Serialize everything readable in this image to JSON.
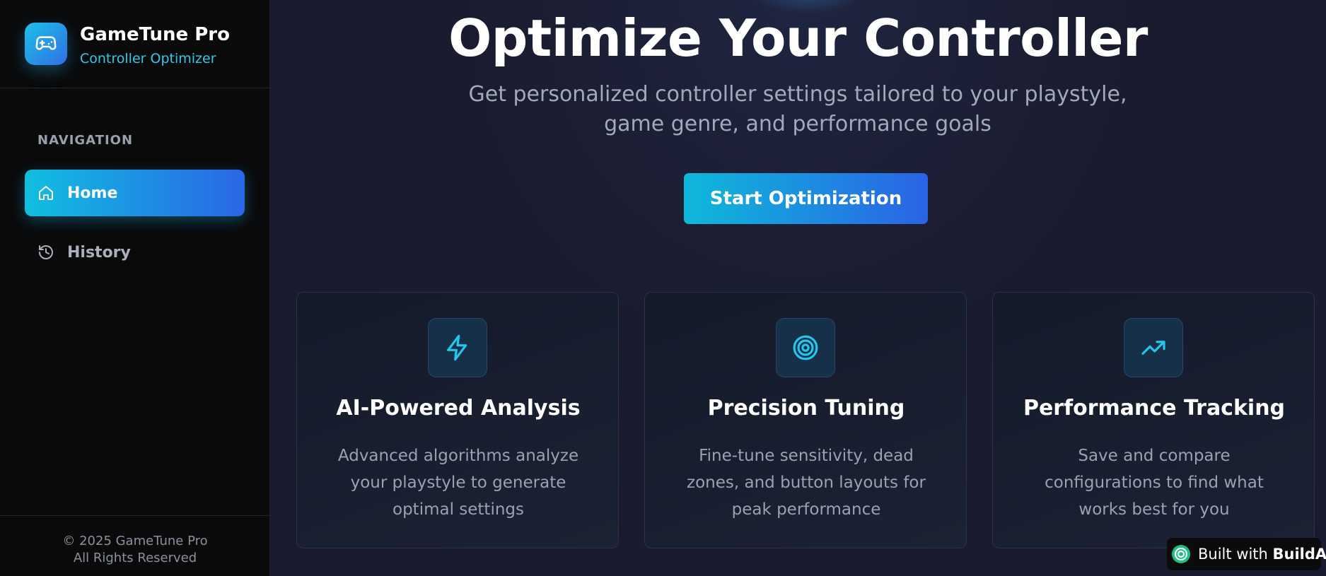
{
  "brand": {
    "title": "GameTune Pro",
    "subtitle": "Controller Optimizer",
    "logo_icon": "gamepad-icon"
  },
  "sidebar": {
    "heading": "NAVIGATION",
    "items": [
      {
        "label": "Home",
        "icon": "home-icon",
        "active": true
      },
      {
        "label": "History",
        "icon": "history-icon",
        "active": false
      }
    ],
    "footer": {
      "copyright": "© 2025 GameTune Pro",
      "rights": "All Rights Reserved"
    }
  },
  "hero": {
    "title": "Optimize Your Controller",
    "subtitle": "Get personalized controller settings tailored to your playstyle, game genre, and performance goals",
    "cta_label": "Start Optimization"
  },
  "features": [
    {
      "icon": "lightning-icon",
      "title": "AI-Powered Analysis",
      "description": "Advanced algorithms analyze your playstyle to generate optimal settings"
    },
    {
      "icon": "target-icon",
      "title": "Precision Tuning",
      "description": "Fine-tune sensitivity, dead zones, and button layouts for peak performance"
    },
    {
      "icon": "trending-up-icon",
      "title": "Performance Tracking",
      "description": "Save and compare configurations to find what works best for you"
    }
  ],
  "badge": {
    "prefix": "Built with ",
    "brand": "BuildAI"
  },
  "colors": {
    "accent_cyan": "#10bfe0",
    "accent_blue": "#2a66e6",
    "sidebar_bg": "#0a0a0b",
    "main_bg": "#1a1b2e"
  }
}
